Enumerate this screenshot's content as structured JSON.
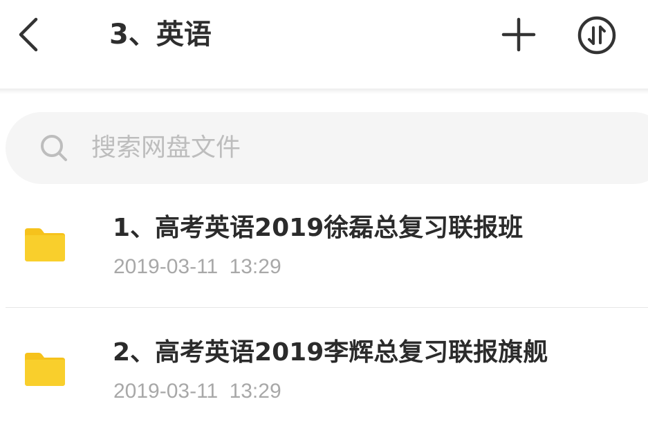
{
  "header": {
    "title": "3、英语",
    "back_icon": "chevron-left-icon",
    "add_icon": "plus-icon",
    "sort_icon": "sort-arrows-icon"
  },
  "search": {
    "placeholder": "搜索网盘文件",
    "icon": "search-icon"
  },
  "files": [
    {
      "name": "1、高考英语2019徐磊总复习联报班",
      "date": "2019-03-11 13:29",
      "icon": "folder-icon"
    },
    {
      "name": "2、高考英语2019李辉总复习联报旗舰",
      "date": "2019-03-11 13:29",
      "icon": "folder-icon"
    }
  ],
  "colors": {
    "folder": "#f9cf2c",
    "folder_tab": "#f6c21c",
    "title_text": "#2e2e2e",
    "secondary_text": "#a8a8a8",
    "search_bg": "#f5f5f5",
    "placeholder_text": "#bdbdbd"
  }
}
